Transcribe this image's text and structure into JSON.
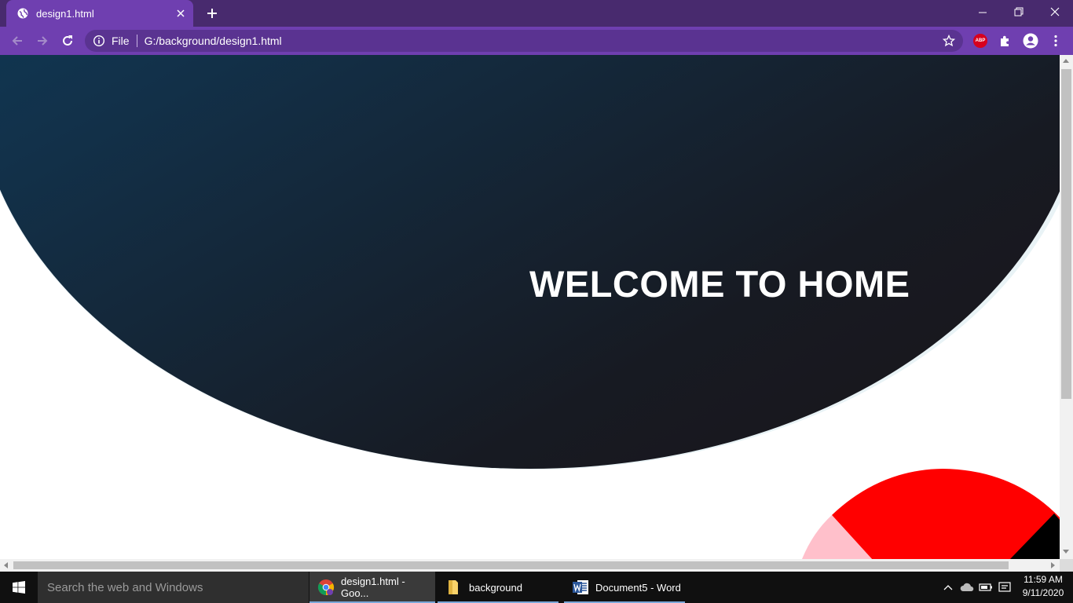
{
  "browser": {
    "tab_title": "design1.html",
    "omnibox": {
      "scheme_label": "File",
      "url": "G:/background/design1.html"
    },
    "extensions": {
      "abp_label": "ABP"
    },
    "colors": {
      "frame": "#482a6e",
      "toolbar": "#6f3fb0"
    }
  },
  "page": {
    "heading": "WELCOME TO HOME",
    "colors": {
      "gradient_start": "#0a4263",
      "gradient_end": "#1a1419",
      "accent_red": "#ff0000",
      "accent_pink": "#ffc0cb"
    }
  },
  "taskbar": {
    "search_placeholder": "Search the web and Windows",
    "tasks": [
      {
        "label": "design1.html - Goo...",
        "icon": "chrome-icon"
      },
      {
        "label": "background",
        "icon": "folder-icon"
      },
      {
        "label": "Document5 - Word",
        "icon": "word-icon"
      }
    ],
    "clock": {
      "time": "11:59 AM",
      "date": "9/11/2020"
    }
  }
}
